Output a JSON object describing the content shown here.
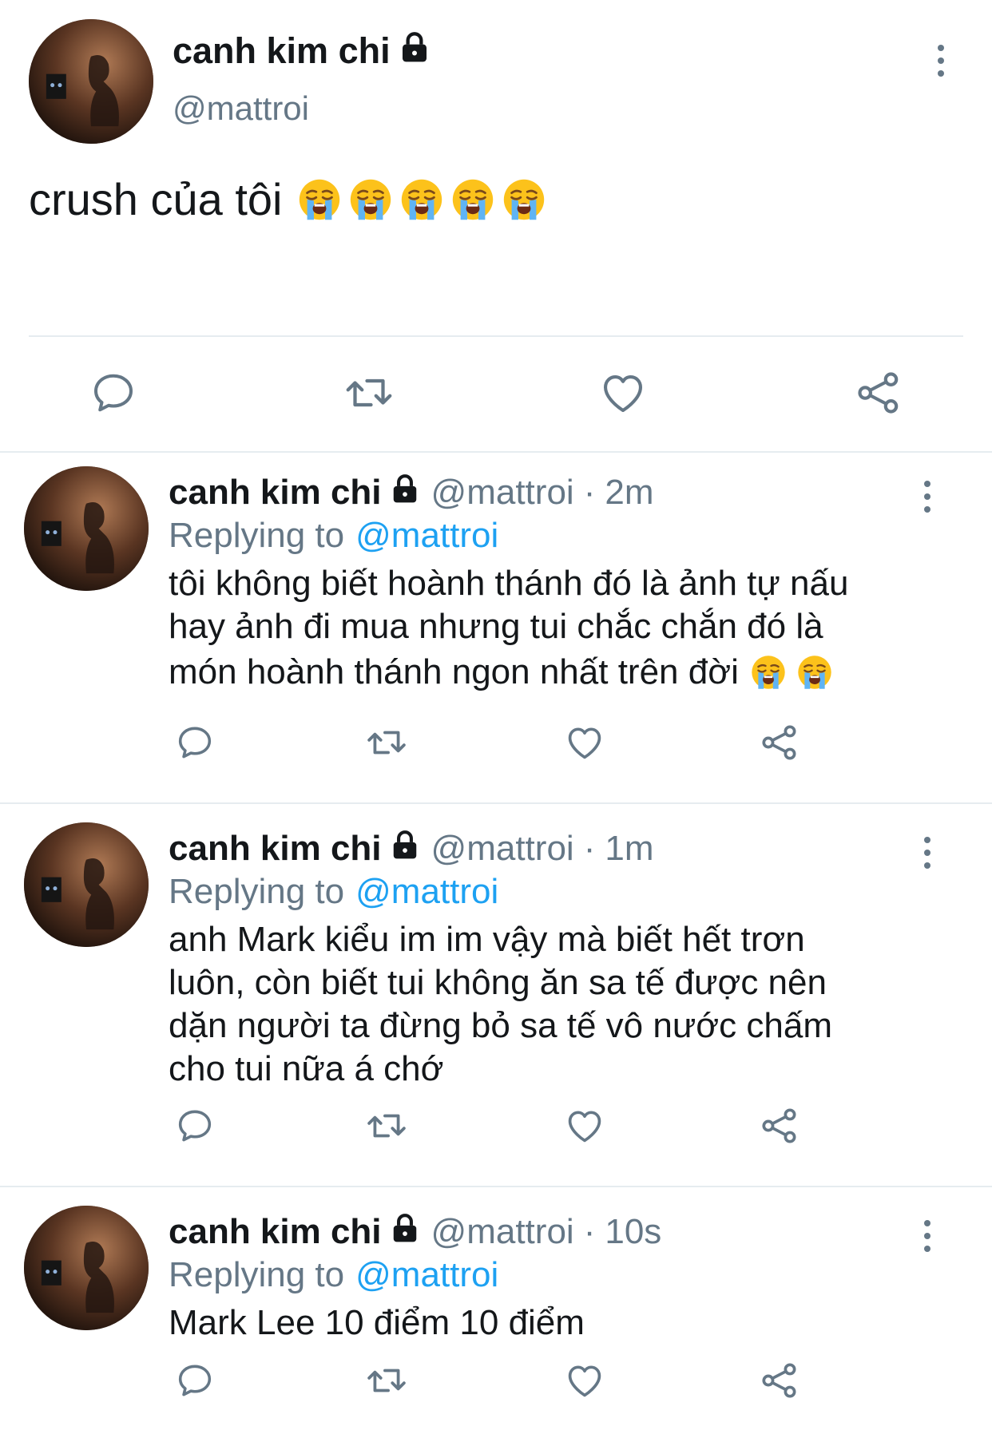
{
  "main_tweet": {
    "display_name": "canh kim chi",
    "handle": "@mattroi",
    "text": "crush của tôi",
    "emoji_count": 5,
    "emoji": "loudly-crying-face"
  },
  "replies": [
    {
      "display_name": "canh kim chi",
      "handle": "@mattroi",
      "separator": "·",
      "time": "2m",
      "replying_prefix": "Replying to",
      "replying_mention": "@mattroi",
      "lines": [
        "tôi không biết hoành thánh đó là ảnh tự nấu",
        "hay ảnh đi mua nhưng tui chắc chắn đó là",
        "món hoành thánh ngon nhất trên đời"
      ],
      "emoji_count": 2
    },
    {
      "display_name": "canh kim chi",
      "handle": "@mattroi",
      "separator": "·",
      "time": "1m",
      "replying_prefix": "Replying to",
      "replying_mention": "@mattroi",
      "lines": [
        "anh Mark kiểu im im vậy mà biết hết trơn",
        "luôn, còn biết tui không ăn sa tế được nên",
        "dặn người ta đừng bỏ sa tế vô nước chấm",
        "cho tui nữa á chớ"
      ],
      "emoji_count": 0
    },
    {
      "display_name": "canh kim chi",
      "handle": "@mattroi",
      "separator": "·",
      "time": "10s",
      "replying_prefix": "Replying to",
      "replying_mention": "@mattroi",
      "lines": [
        "Mark Lee 10 điểm 10 điểm"
      ],
      "emoji_count": 0
    }
  ],
  "icons": {
    "reply": "speech-bubble-icon",
    "retweet": "retweet-icon",
    "like": "heart-icon",
    "share": "share-icon",
    "lock": "lock-icon",
    "more": "vertical-ellipsis-icon"
  },
  "colors": {
    "text": "#14171a",
    "secondary": "#657786",
    "link": "#1da1f2",
    "divider": "#e6ecf0"
  }
}
